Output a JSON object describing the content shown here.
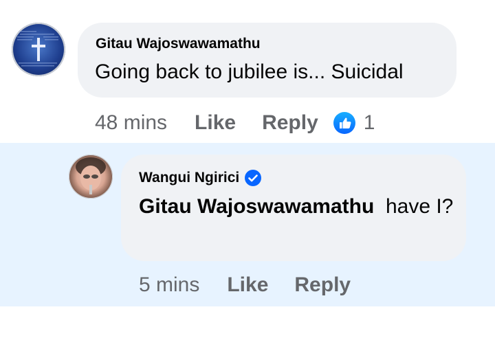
{
  "comments": [
    {
      "author": "Gitau Wajoswawamathu",
      "text": "Going back to jubilee is... Suicidal",
      "time": "48 mins",
      "like_label": "Like",
      "reply_label": "Reply",
      "reaction_icon": "thumbs-up-icon",
      "reaction_count": "1"
    }
  ],
  "reply": {
    "author": "Wangui Ngirici",
    "verified_icon": "verified-badge-icon",
    "mention": "Gitau Wajoswawamathu",
    "text": "have I?",
    "time": "5 mins",
    "like_label": "Like",
    "reply_label": "Reply"
  },
  "colors": {
    "bubble": "#f0f2f5",
    "reply_highlight": "#e7f3ff",
    "secondary_text": "#65676b",
    "brand_blue": "#0866ff"
  }
}
